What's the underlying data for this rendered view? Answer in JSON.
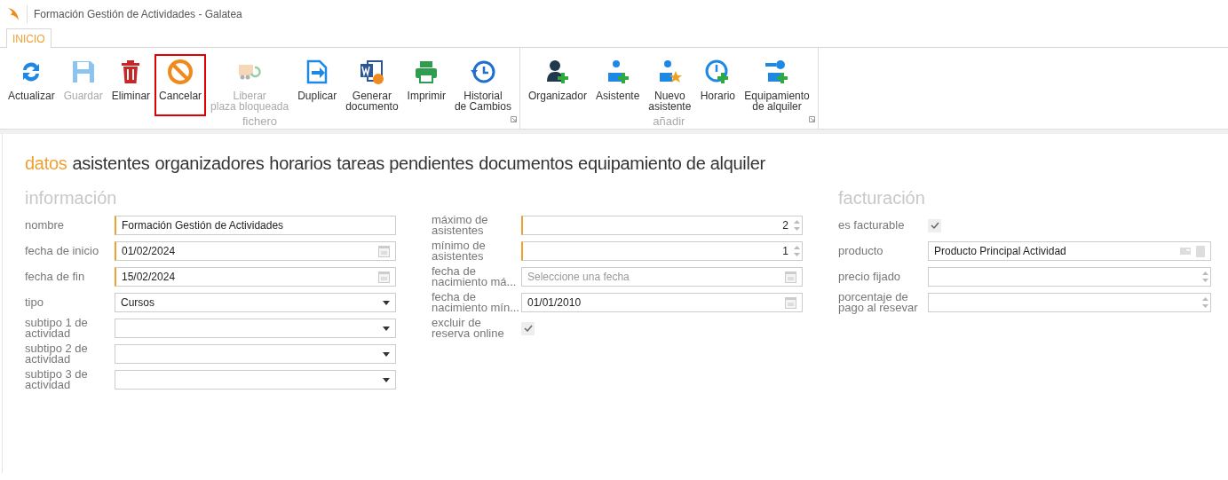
{
  "window": {
    "title": "Formación Gestión de Actividades - Galatea"
  },
  "ribbon_tabs": [
    {
      "label": "INICIO",
      "selected": true
    }
  ],
  "ribbon_groups": [
    {
      "label": "fichero",
      "buttons": [
        {
          "label": "Actualizar",
          "disabled": false,
          "highlighted": false
        },
        {
          "label": "Guardar",
          "disabled": true,
          "highlighted": false
        },
        {
          "label": "Eliminar",
          "disabled": false,
          "highlighted": false
        },
        {
          "label": "Cancelar",
          "disabled": false,
          "highlighted": true
        },
        {
          "label": "Liberar\nplaza bloqueada",
          "disabled": true,
          "highlighted": false
        },
        {
          "label": "Duplicar",
          "disabled": false,
          "highlighted": false
        },
        {
          "label": "Generar\ndocumento",
          "disabled": false,
          "highlighted": false
        },
        {
          "label": "Imprimir",
          "disabled": false,
          "highlighted": false
        },
        {
          "label": "Historial\nde Cambios",
          "disabled": false,
          "highlighted": false
        }
      ]
    },
    {
      "label": "añadir",
      "buttons": [
        {
          "label": "Organizador",
          "disabled": false,
          "highlighted": false
        },
        {
          "label": "Asistente",
          "disabled": false,
          "highlighted": false
        },
        {
          "label": "Nuevo\nasistente",
          "disabled": false,
          "highlighted": false
        },
        {
          "label": "Horario",
          "disabled": false,
          "highlighted": false
        },
        {
          "label": "Equipamiento\nde alquiler",
          "disabled": false,
          "highlighted": false
        }
      ]
    }
  ],
  "section_tabs": [
    {
      "label": "datos",
      "selected": true
    },
    {
      "label": "asistentes",
      "selected": false
    },
    {
      "label": "organizadores",
      "selected": false
    },
    {
      "label": "horarios",
      "selected": false
    },
    {
      "label": "tareas pendientes",
      "selected": false
    },
    {
      "label": "documentos",
      "selected": false
    },
    {
      "label": "equipamiento de alquiler",
      "selected": false
    }
  ],
  "sections": [
    {
      "title": "información",
      "fields": [
        {
          "label": "nombre",
          "kind": "text",
          "value": "Formación Gestión de Actividades",
          "required": true
        },
        {
          "label": "fecha de inicio",
          "kind": "date",
          "value": "01/02/2024",
          "required": true
        },
        {
          "label": "fecha de fin",
          "kind": "date",
          "value": "15/02/2024",
          "required": true
        },
        {
          "label": "tipo",
          "kind": "select",
          "value": "Cursos",
          "required": false
        },
        {
          "label": "subtipo 1 de actividad",
          "kind": "select",
          "required": false
        },
        {
          "label": "subtipo 2 de actividad",
          "kind": "select",
          "required": false
        },
        {
          "label": "subtipo 3 de actividad",
          "kind": "select",
          "required": false
        }
      ]
    },
    {
      "fields": [
        {
          "label": "máximo de asistentes",
          "kind": "number",
          "value": "2",
          "required": true
        },
        {
          "label": "mínimo de asistentes",
          "kind": "number",
          "value": "1",
          "required": true
        },
        {
          "label": "fecha de nacimiento má...",
          "kind": "date",
          "placeholder": "Seleccione una fecha",
          "required": false
        },
        {
          "label": "fecha de nacimiento mín...",
          "kind": "date",
          "value": "01/01/2010",
          "required": false
        },
        {
          "label": "excluir de reserva online",
          "kind": "checkbox",
          "checked": true
        }
      ]
    },
    {
      "title": "facturación",
      "fields": [
        {
          "label": "es facturable",
          "kind": "checkbox",
          "checked": true
        },
        {
          "label": "producto",
          "kind": "lookup",
          "value": "Producto Principal Actividad",
          "required": false
        },
        {
          "label": "precio fijado",
          "kind": "number",
          "required": false
        },
        {
          "label": "porcentaje de pago al resevar",
          "kind": "number",
          "required": false
        }
      ]
    }
  ]
}
